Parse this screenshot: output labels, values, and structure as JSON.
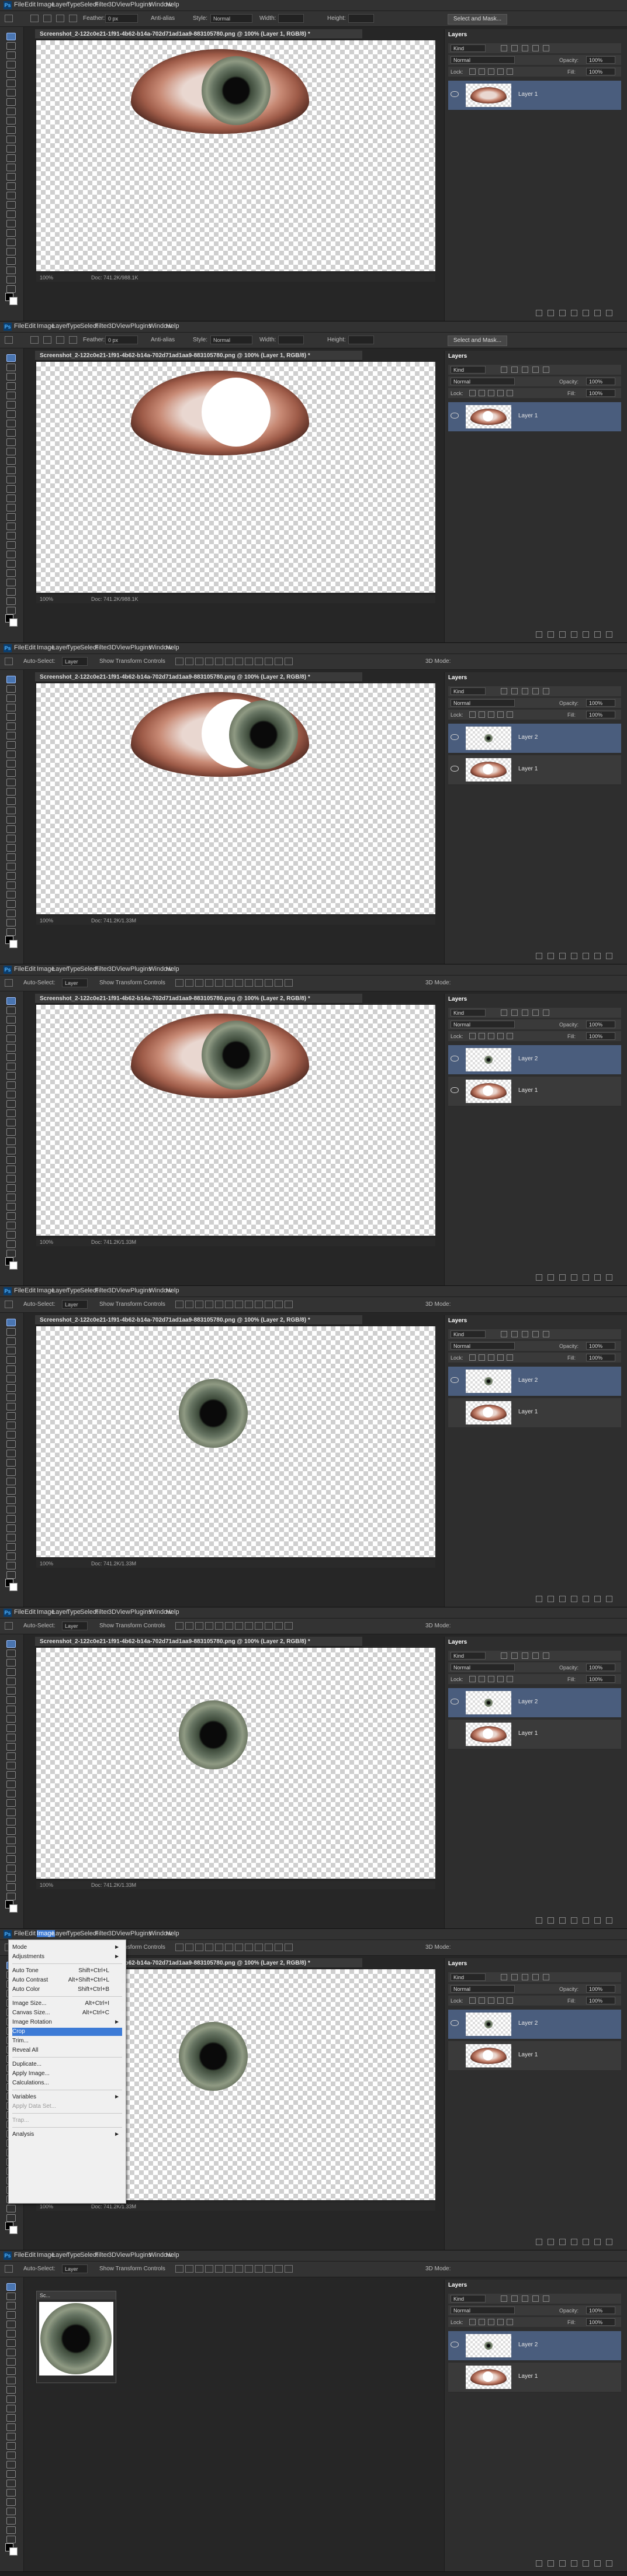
{
  "menu": [
    "File",
    "Edit",
    "Image",
    "Layer",
    "Type",
    "Select",
    "Filter",
    "3D",
    "View",
    "Plugins",
    "Window",
    "Help"
  ],
  "colors": {
    "accent": "#4a5d7d",
    "app_bg": "#262626",
    "menu_highlight": "#3d7bd6"
  },
  "icons": [
    "photoshop-logo-icon",
    "eye-visibility-icon",
    "move-tool-icon",
    "marquee-tool-icon",
    "lasso-tool-icon",
    "brush-tool-icon",
    "eraser-tool-icon",
    "zoom-tool-icon",
    "hand-tool-icon",
    "new-layer-icon",
    "trash-icon"
  ],
  "marquee_options": {
    "feather_label": "Feather:",
    "feather_value": "0 px",
    "antialias": "Anti-alias",
    "style_label": "Style:",
    "style_value": "Normal",
    "width_label": "Width:",
    "height_label": "Height:",
    "select_mask": "Select and Mask..."
  },
  "move_options": {
    "auto_select": "Auto-Select:",
    "layer_value": "Layer",
    "show_transform": "Show Transform Controls",
    "mode_3d": "3D Mode:"
  },
  "panel": {
    "tab": "Layers",
    "kind": "Kind",
    "blend": "Normal",
    "opacity_label": "Opacity:",
    "opacity_value": "100%",
    "lock_label": "Lock:",
    "fill_label": "Fill:",
    "fill_value": "100%"
  },
  "layer1": "Layer 1",
  "layer2": "Layer 2",
  "status": {
    "zoom": "100%",
    "docsize": "Doc: 741.2K/741.2K"
  },
  "frames": [
    {
      "title": "Screenshot_2-122c0e21-1f91-4b62-b14a-702d71ad1aa9-883105780.png @ 100% (Layer 1, RGB/8) *",
      "status_doc": "Doc: 741.2K/988.1K"
    },
    {
      "title": "Screenshot_2-122c0e21-1f91-4b62-b14a-702d71ad1aa9-883105780.png @ 100% (Layer 1, RGB/8) *",
      "status_doc": "Doc: 741.2K/988.1K"
    },
    {
      "title": "Screenshot_2-122c0e21-1f91-4b62-b14a-702d71ad1aa9-883105780.png @ 100% (Layer 2, RGB/8) *",
      "status_doc": "Doc: 741.2K/1.33M"
    },
    {
      "title": "Screenshot_2-122c0e21-1f91-4b62-b14a-702d71ad1aa9-883105780.png @ 100% (Layer 2, RGB/8) *",
      "status_doc": "Doc: 741.2K/1.33M"
    },
    {
      "title": "Screenshot_2-122c0e21-1f91-4b62-b14a-702d71ad1aa9-883105780.png @ 100% (Layer 2, RGB/8) *",
      "status_doc": "Doc: 741.2K/1.33M"
    },
    {
      "title": "Screenshot_2-122c0e21-1f91-4b62-b14a-702d71ad1aa9-883105780.png @ 100% (Layer 2, RGB/8) *",
      "status_doc": "Doc: 741.2K/1.33M"
    },
    {
      "title": "Screenshot_2-122c0e21-1f91-4b62-b14a-702d71ad1aa9-883105780.png @ 100% (Layer 2, RGB/8) *",
      "status_doc": "Doc: 741.2K/1.33M"
    },
    {
      "title": "Sc...",
      "status_doc": ""
    }
  ],
  "image_menu": [
    {
      "label": "Mode",
      "arrow": "►"
    },
    {
      "label": "Adjustments",
      "arrow": "►"
    },
    {
      "label": "Auto Tone",
      "short": "Shift+Ctrl+L"
    },
    {
      "label": "Auto Contrast",
      "short": "Alt+Shift+Ctrl+L"
    },
    {
      "label": "Auto Color",
      "short": "Shift+Ctrl+B"
    },
    {
      "label": "Image Size...",
      "short": "Alt+Ctrl+I"
    },
    {
      "label": "Canvas Size...",
      "short": "Alt+Ctrl+C"
    },
    {
      "label": "Image Rotation",
      "arrow": "►"
    },
    {
      "label": "Crop"
    },
    {
      "label": "Trim..."
    },
    {
      "label": "Reveal All"
    },
    {
      "label": "Duplicate..."
    },
    {
      "label": "Apply Image..."
    },
    {
      "label": "Calculations..."
    },
    {
      "label": "Variables",
      "arrow": "►"
    },
    {
      "label": "Apply Data Set..."
    },
    {
      "label": "Trap..."
    },
    {
      "label": "Analysis",
      "arrow": "►"
    }
  ]
}
